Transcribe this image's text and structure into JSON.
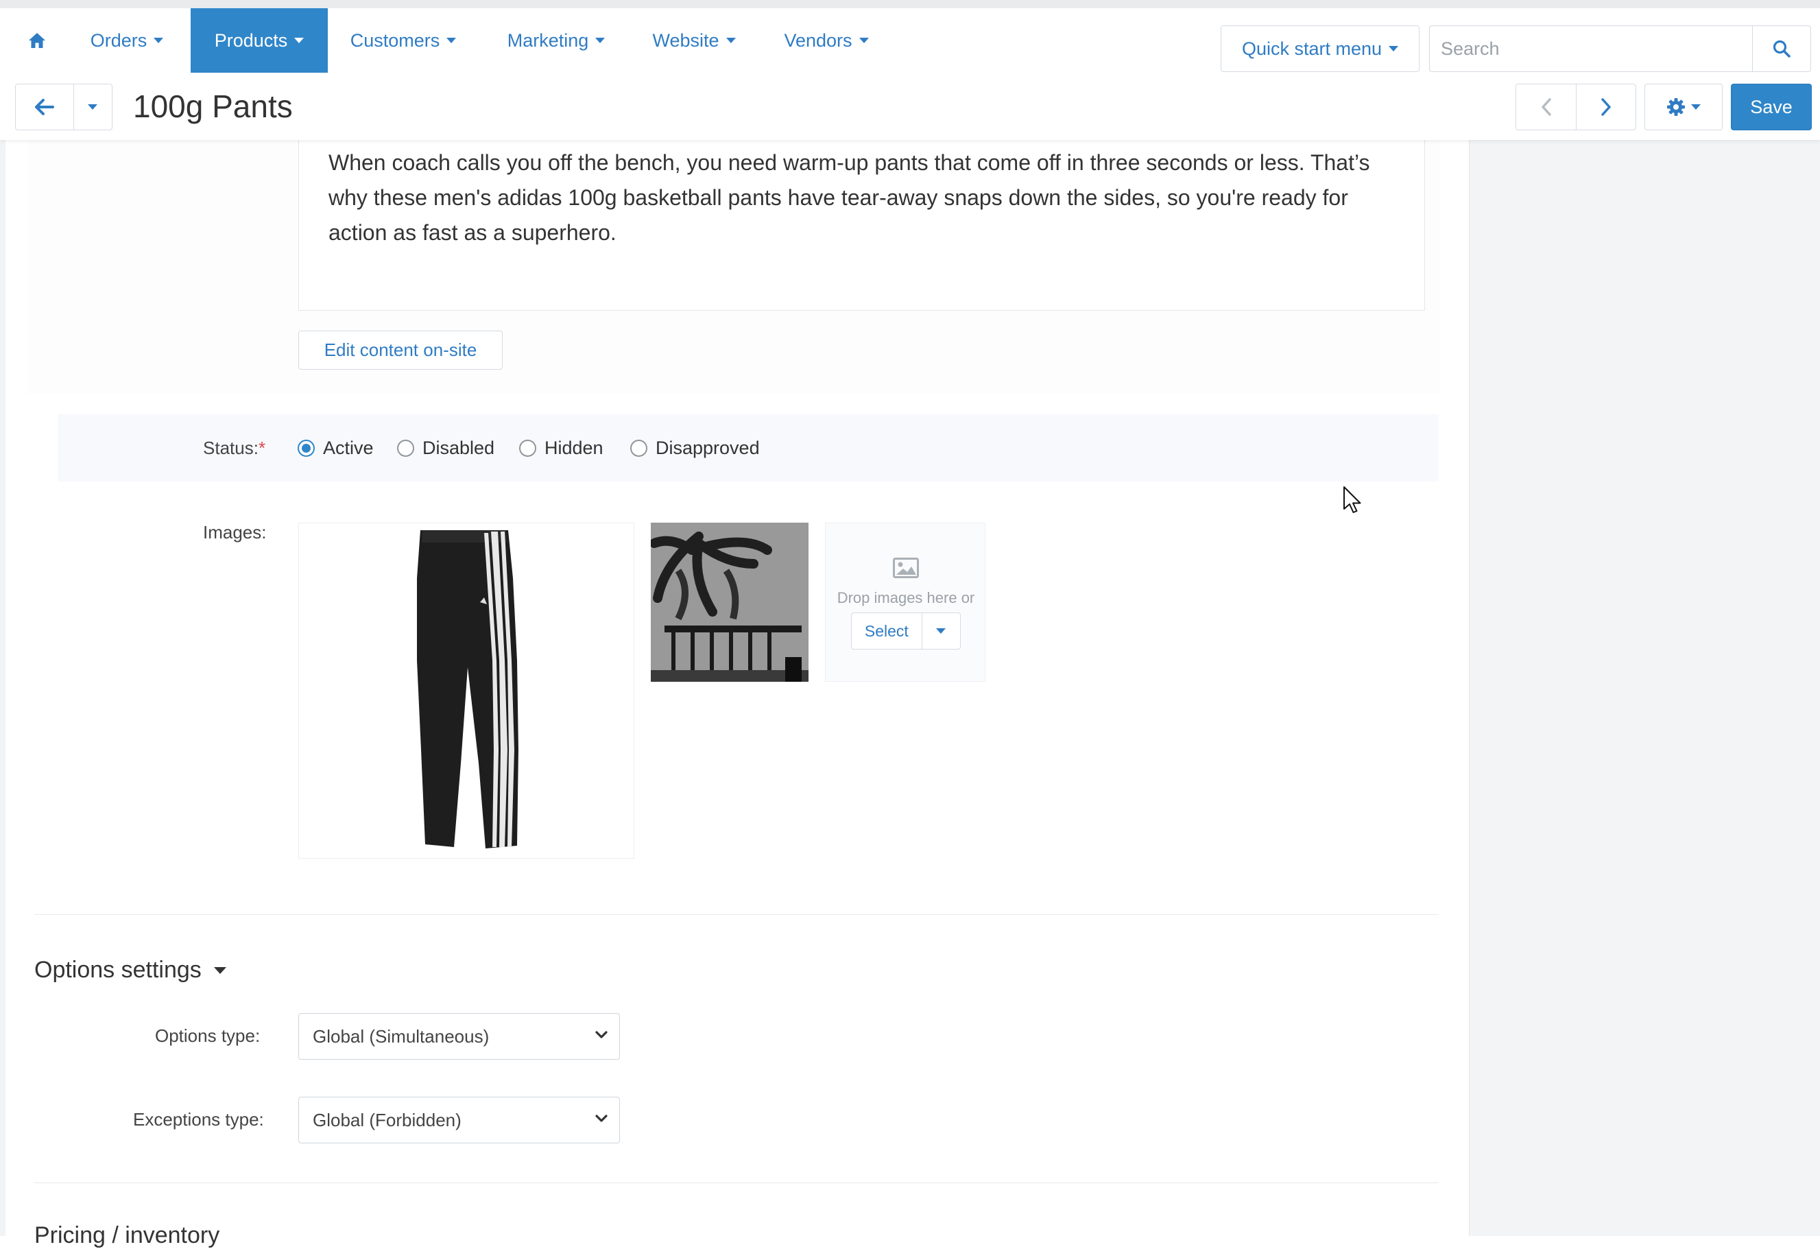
{
  "nav": {
    "items": [
      {
        "label": "Orders"
      },
      {
        "label": "Products"
      },
      {
        "label": "Customers"
      },
      {
        "label": "Marketing"
      },
      {
        "label": "Website"
      },
      {
        "label": "Vendors"
      }
    ],
    "active_index": 1,
    "quick_start_label": "Quick start menu",
    "search_placeholder": "Search"
  },
  "header": {
    "title": "100g Pants",
    "save_label": "Save"
  },
  "description": {
    "text": "When coach calls you off the bench, you need warm-up pants that come off in three seconds or less. That’s why these men's adidas 100g basketball pants have tear-away snaps down the sides, so you're ready for action as fast as a superhero.",
    "edit_button_label": "Edit content on-site"
  },
  "status": {
    "label": "Status:",
    "required_mark": "*",
    "options": [
      "Active",
      "Disabled",
      "Hidden",
      "Disapproved"
    ],
    "selected": "Active"
  },
  "images": {
    "label": "Images:",
    "drop_text": "Drop images here or",
    "select_label": "Select"
  },
  "options_settings": {
    "title": "Options settings",
    "options_type_label": "Options type:",
    "options_type_value": "Global (Simultaneous)",
    "exceptions_type_label": "Exceptions type:",
    "exceptions_type_value": "Global (Forbidden)"
  },
  "next_section": {
    "title": "Pricing / inventory"
  },
  "colors": {
    "accent": "#2f86c9",
    "link": "#2f7cc4",
    "required": "#e04848"
  }
}
